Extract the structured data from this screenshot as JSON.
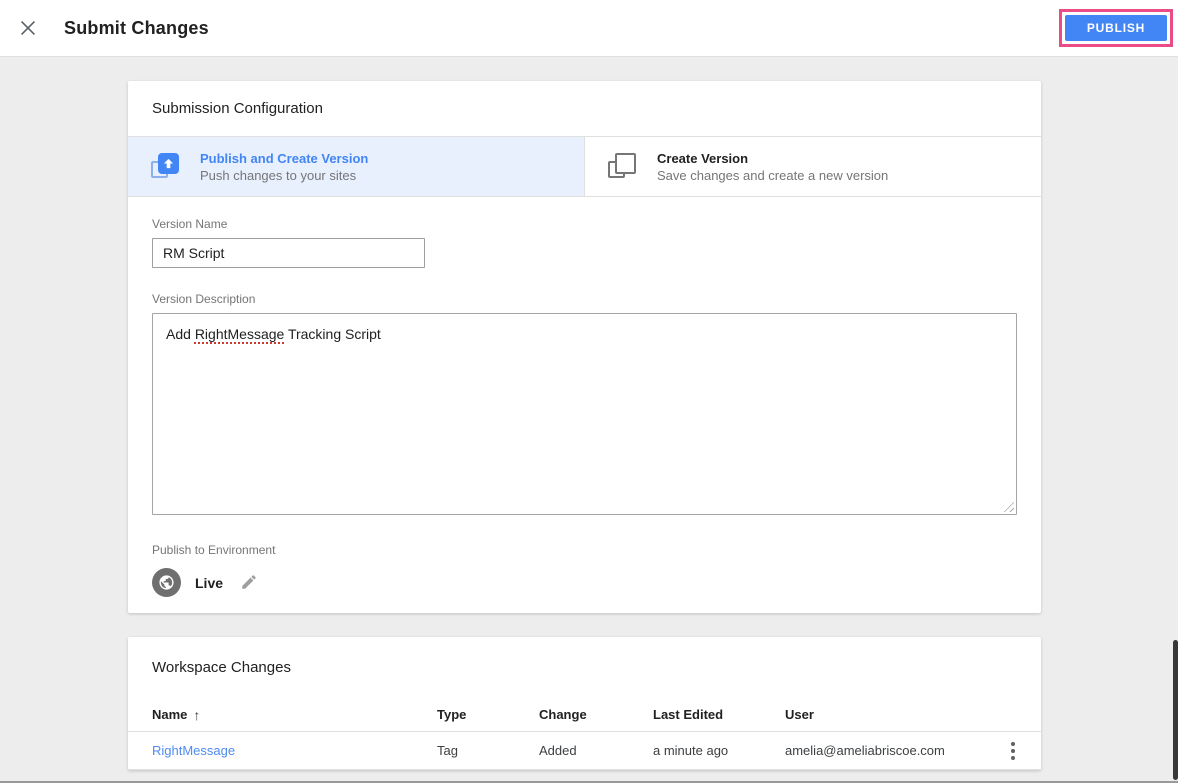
{
  "colors": {
    "accent_blue": "#4285f4",
    "selected_tab_background": "#e8f0fe",
    "annotation_pink": "#ea4c87",
    "link_blue": "#4e8cf0",
    "page_background": "#ededed"
  },
  "top_bar": {
    "title": "Submit Changes",
    "publish_button": "PUBLISH"
  },
  "submission_card": {
    "title": "Submission Configuration",
    "tabs": [
      {
        "title": "Publish and Create Version",
        "subtitle": "Push changes to your sites",
        "selected": true
      },
      {
        "title": "Create Version",
        "subtitle": "Save changes and create a new version",
        "selected": false
      }
    ],
    "version_name": {
      "label": "Version Name",
      "value": "RM Script"
    },
    "version_description": {
      "label": "Version Description",
      "text_before": "Add ",
      "text_misspelled": "RightMessage",
      "text_after": " Tracking Script"
    },
    "environment": {
      "label": "Publish to Environment",
      "name": "Live"
    }
  },
  "workspace_card": {
    "title": "Workspace Changes",
    "sort_arrow": "↑",
    "columns": {
      "name": "Name",
      "type": "Type",
      "change": "Change",
      "last_edited": "Last Edited",
      "user": "User"
    },
    "rows": [
      {
        "name": "RightMessage",
        "type": "Tag",
        "change": "Added",
        "last_edited": "a minute ago",
        "user": "amelia@ameliabriscoe.com"
      }
    ]
  }
}
